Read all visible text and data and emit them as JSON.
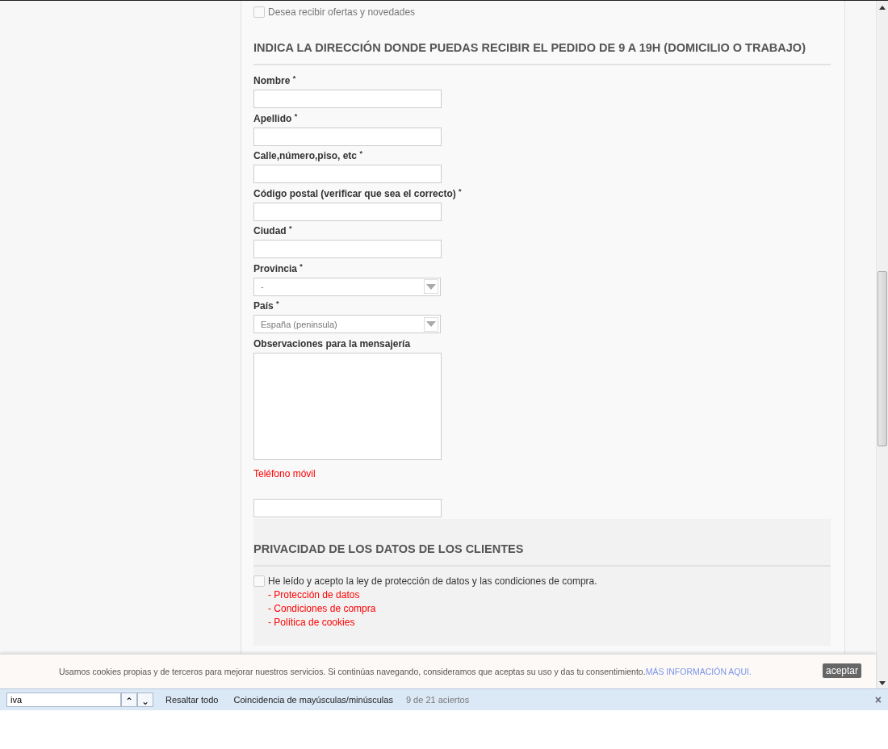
{
  "newsletter": {
    "label": "Desea recibir ofertas y novedades",
    "checked": false
  },
  "address_section": {
    "heading": "INDICA LA DIRECCIÓN DONDE PUEDAS RECIBIR EL PEDIDO DE 9 A 19H (DOMICILIO O TRABAJO)",
    "fields": [
      {
        "kind": "text",
        "label": "Nombre $^{*}$"
      },
      {
        "kind": "text",
        "label": "Apellido $^{*}$"
      },
      {
        "kind": "text",
        "label": "Calle,número,piso, etc $^{*}$"
      },
      {
        "kind": "text",
        "label": "Código postal (verificar que sea el correcto) $^{*}$"
      },
      {
        "kind": "text",
        "label": "Ciudad $^{*}$"
      },
      {
        "kind": "select",
        "label": "Provincia $^{*}$",
        "value": "-"
      },
      {
        "kind": "select",
        "label": "País $^{*}$",
        "value": "España (peninsula)"
      },
      {
        "kind": "textarea",
        "label": "Observaciones para la mensajería"
      },
      {
        "kind": "phone",
        "label": "Teléfono móvil"
      }
    ]
  },
  "privacy_section": {
    "heading": "PRIVACIDAD DE LOS DATOS DE LOS CLIENTES",
    "consent": {
      "label": "He leído y acepto la ley de protección de datos y las condiciones de compra.",
      "checked": false
    },
    "links": [
      "- Protección de datos",
      "- Condiciones de compra",
      "- Política de cookies"
    ]
  },
  "cookie_banner": {
    "text": "Usamos cookies propias y de terceros para mejorar nuestros servicios. Si continúas navegando, consideramos que aceptas su uso y das tu consentimiento.",
    "link": "MÁS INFORMACIÓN AQUI.",
    "button": "aceptar"
  },
  "find_bar": {
    "query": "iva",
    "up": "⌃",
    "down": "⌄",
    "highlight_all": "Resaltar todo",
    "match_case": "Coincidencia de mayúsculas/minúsculas",
    "result": "9 de 21 aciertos",
    "close": "×"
  }
}
